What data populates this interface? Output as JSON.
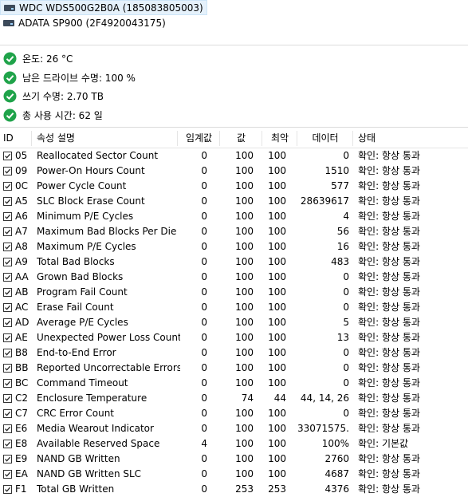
{
  "drives": [
    {
      "label": "WDC WDS500G2B0A (185083805003)",
      "selected": true
    },
    {
      "label": "ADATA SP900 (2F4920043175)",
      "selected": false
    }
  ],
  "status": [
    {
      "text": "온도: 26 °C"
    },
    {
      "text": "남은 드라이브 수명: 100 %"
    },
    {
      "text": "쓰기 수명: 2.70 TB"
    },
    {
      "text": "총 사용 시간: 62 일"
    }
  ],
  "colors": {
    "ok_green": "#1fa34a",
    "selection": "#e5f1fb"
  },
  "table": {
    "headers": {
      "id": "ID",
      "name": "속성 설명",
      "threshold": "임계값",
      "value": "값",
      "worst": "최악",
      "data": "데이터",
      "state": "상태"
    },
    "rows": [
      {
        "id": "05",
        "name": "Reallocated Sector Count",
        "threshold": "0",
        "value": "100",
        "worst": "100",
        "data": "0",
        "state": "확인: 항상 통과"
      },
      {
        "id": "09",
        "name": "Power-On Hours Count",
        "threshold": "0",
        "value": "100",
        "worst": "100",
        "data": "1510",
        "state": "확인: 항상 통과"
      },
      {
        "id": "0C",
        "name": "Power Cycle Count",
        "threshold": "0",
        "value": "100",
        "worst": "100",
        "data": "577",
        "state": "확인: 항상 통과"
      },
      {
        "id": "A5",
        "name": "SLC Block Erase Count",
        "threshold": "0",
        "value": "100",
        "worst": "100",
        "data": "28639617",
        "state": "확인: 항상 통과"
      },
      {
        "id": "A6",
        "name": "Minimum P/E Cycles",
        "threshold": "0",
        "value": "100",
        "worst": "100",
        "data": "4",
        "state": "확인: 항상 통과"
      },
      {
        "id": "A7",
        "name": "Maximum Bad Blocks Per Die",
        "threshold": "0",
        "value": "100",
        "worst": "100",
        "data": "56",
        "state": "확인: 항상 통과"
      },
      {
        "id": "A8",
        "name": "Maximum P/E Cycles",
        "threshold": "0",
        "value": "100",
        "worst": "100",
        "data": "16",
        "state": "확인: 항상 통과"
      },
      {
        "id": "A9",
        "name": "Total Bad Blocks",
        "threshold": "0",
        "value": "100",
        "worst": "100",
        "data": "483",
        "state": "확인: 항상 통과"
      },
      {
        "id": "AA",
        "name": "Grown Bad Blocks",
        "threshold": "0",
        "value": "100",
        "worst": "100",
        "data": "0",
        "state": "확인: 항상 통과"
      },
      {
        "id": "AB",
        "name": "Program Fail Count",
        "threshold": "0",
        "value": "100",
        "worst": "100",
        "data": "0",
        "state": "확인: 항상 통과"
      },
      {
        "id": "AC",
        "name": "Erase Fail Count",
        "threshold": "0",
        "value": "100",
        "worst": "100",
        "data": "0",
        "state": "확인: 항상 통과"
      },
      {
        "id": "AD",
        "name": "Average P/E Cycles",
        "threshold": "0",
        "value": "100",
        "worst": "100",
        "data": "5",
        "state": "확인: 항상 통과"
      },
      {
        "id": "AE",
        "name": "Unexpected Power Loss Count",
        "threshold": "0",
        "value": "100",
        "worst": "100",
        "data": "13",
        "state": "확인: 항상 통과"
      },
      {
        "id": "B8",
        "name": "End-to-End Error",
        "threshold": "0",
        "value": "100",
        "worst": "100",
        "data": "0",
        "state": "확인: 항상 통과"
      },
      {
        "id": "BB",
        "name": "Reported Uncorrectable Errors",
        "threshold": "0",
        "value": "100",
        "worst": "100",
        "data": "0",
        "state": "확인: 항상 통과"
      },
      {
        "id": "BC",
        "name": "Command Timeout",
        "threshold": "0",
        "value": "100",
        "worst": "100",
        "data": "0",
        "state": "확인: 항상 통과"
      },
      {
        "id": "C2",
        "name": "Enclosure Temperature",
        "threshold": "0",
        "value": "74",
        "worst": "44",
        "data": "44, 14, 26",
        "state": "확인: 항상 통과"
      },
      {
        "id": "C7",
        "name": "CRC Error Count",
        "threshold": "0",
        "value": "100",
        "worst": "100",
        "data": "0",
        "state": "확인: 항상 통과"
      },
      {
        "id": "E6",
        "name": "Media Wearout Indicator",
        "threshold": "0",
        "value": "100",
        "worst": "100",
        "data": "33071575...",
        "state": "확인: 항상 통과"
      },
      {
        "id": "E8",
        "name": "Available Reserved Space",
        "threshold": "4",
        "value": "100",
        "worst": "100",
        "data": "100%",
        "state": "확인: 기본값"
      },
      {
        "id": "E9",
        "name": "NAND GB Written",
        "threshold": "0",
        "value": "100",
        "worst": "100",
        "data": "2760",
        "state": "확인: 항상 통과"
      },
      {
        "id": "EA",
        "name": "NAND GB Written SLC",
        "threshold": "0",
        "value": "100",
        "worst": "100",
        "data": "4687",
        "state": "확인: 항상 통과"
      },
      {
        "id": "F1",
        "name": "Total GB Written",
        "threshold": "0",
        "value": "253",
        "worst": "253",
        "data": "4376",
        "state": "확인: 항상 통과"
      }
    ]
  }
}
